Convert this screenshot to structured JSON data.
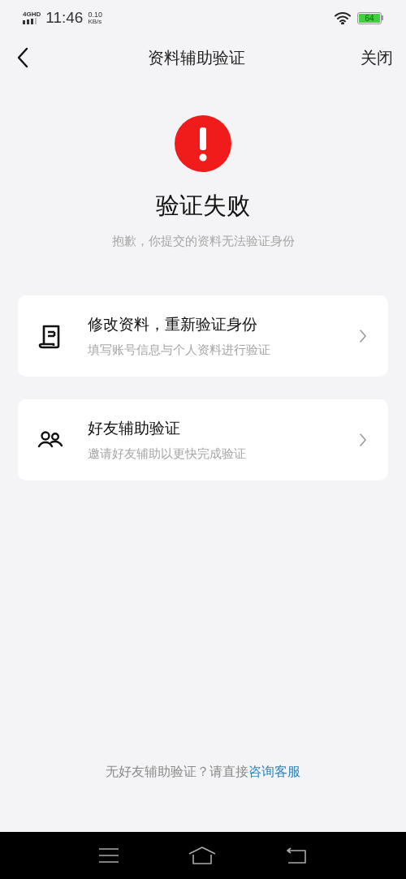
{
  "status_bar": {
    "network": "4GHD",
    "time": "11:46",
    "speed": "0.10",
    "speed_unit": "KB/s",
    "battery": "64"
  },
  "header": {
    "title": "资料辅助验证",
    "close": "关闭"
  },
  "result": {
    "title": "验证失败",
    "message": "抱歉，你提交的资料无法验证身份"
  },
  "options": [
    {
      "kind": "document",
      "title": "修改资料，重新验证身份",
      "subtitle": "填写账号信息与个人资料进行验证"
    },
    {
      "kind": "friends",
      "title": "好友辅助验证",
      "subtitle": "邀请好友辅助以更快完成验证"
    }
  ],
  "footer": {
    "text": "无好友辅助验证？请直接",
    "link": "咨询客服"
  }
}
